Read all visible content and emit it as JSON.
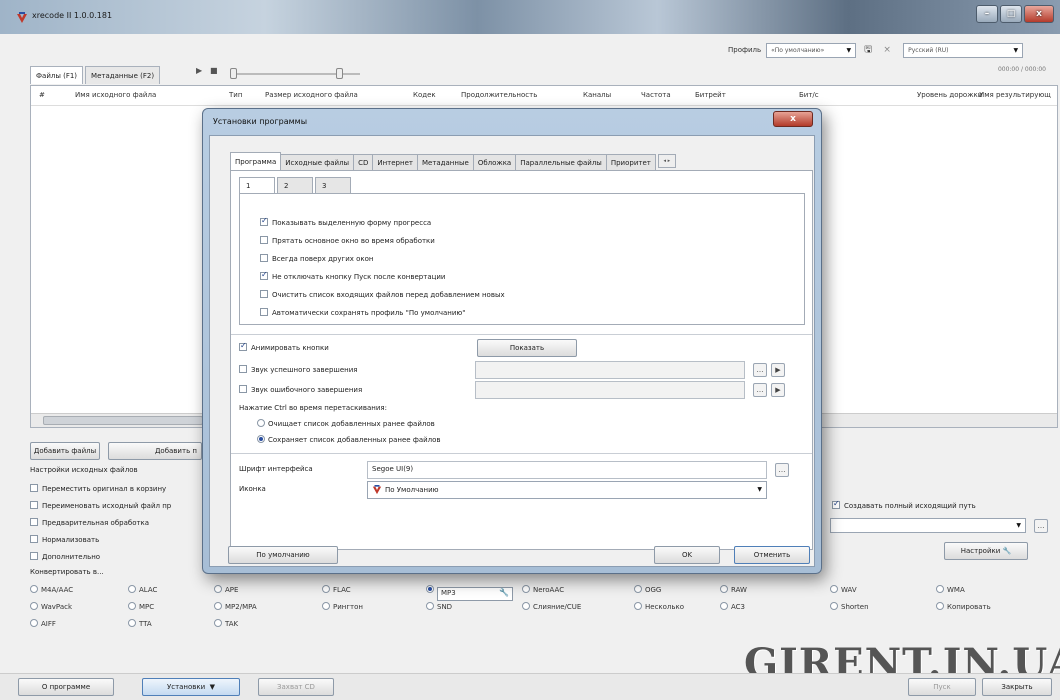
{
  "window": {
    "title": "xrecode II 1.0.0.181",
    "controls": [
      "–",
      "□",
      "x"
    ],
    "profile_label": "Профиль",
    "profile_value": "«По умолчанию»",
    "language_value": "Русский (RU)",
    "time": "000:00 / 000:00"
  },
  "main_tabs": [
    "Файлы (F1)",
    "Метаданные (F2)"
  ],
  "file_columns": [
    "#",
    "Имя исходного файла",
    "Тип",
    "Размер исходного файла",
    "Кодек",
    "Продолжительность",
    "Каналы",
    "Частота",
    "Битрейт",
    "Бит/с",
    "Уровень дорожки",
    "Имя результирующ"
  ],
  "buttons": {
    "add_files": "Добавить файлы",
    "add_folder": "Добавить п",
    "settings": "Настройки",
    "about": "О программе",
    "install": "Установки",
    "grab_cd": "Захват CD",
    "start": "Пуск",
    "close": "Закрыть"
  },
  "source_settings": {
    "title": "Настройки исходных файлов",
    "options": [
      {
        "label": "Переместить оригинал в корзину",
        "checked": false
      },
      {
        "label": "Переименовать исходный файл пр",
        "checked": false
      },
      {
        "label": "Предварительная обработка",
        "checked": false
      },
      {
        "label": "Нормализовать",
        "checked": false
      },
      {
        "label": "Дополнительно",
        "checked": false
      }
    ],
    "full_path_label": "Создавать полный исходящий путь",
    "full_path_checked": true
  },
  "convert": {
    "title": "Конвертировать в...",
    "formats": [
      [
        "M4A/AAC",
        "ALAC",
        "APE",
        "FLAC",
        "MP3",
        "NeroAAC",
        "OGG",
        "RAW",
        "WAV",
        "WMA"
      ],
      [
        "WavPack",
        "MPC",
        "MP2/MPA",
        "Рингтон",
        "SND",
        "Слияние/CUE",
        "Несколько",
        "AC3",
        "Shorten",
        "Копировать"
      ],
      [
        "AIFF",
        "TTA",
        "TAK"
      ]
    ],
    "selected": "MP3"
  },
  "watermark": "GIRENT.IN.UA",
  "dialog": {
    "title": "Установки программы",
    "close": "x",
    "tabs": [
      "Программа",
      "Исходные файлы",
      "CD",
      "Интернет",
      "Метаданные",
      "Обложка",
      "Параллельные файлы",
      "Приоритет"
    ],
    "tab_scroll": [
      "◂",
      "▸"
    ],
    "subtabs": [
      "1",
      "2",
      "3"
    ],
    "options": [
      {
        "label": "Показывать выделенную форму прогресса",
        "checked": true
      },
      {
        "label": "Прятать основное окно во время обработки",
        "checked": false
      },
      {
        "label": "Всегда поверх других окон",
        "checked": false
      },
      {
        "label": "Не отключать кнопку Пуск после конвертации",
        "checked": true
      },
      {
        "label": "Очистить список входящих файлов перед добавлением новых",
        "checked": false
      },
      {
        "label": "Автоматически сохранять профиль \"По умолчанию\"",
        "checked": false
      }
    ],
    "animate": {
      "label": "Анимировать кнопки",
      "checked": true
    },
    "show_button": "Показать",
    "sound_success": {
      "label": "Звук успешного завершения",
      "checked": false
    },
    "sound_error": {
      "label": "Звук ошибочного завершения",
      "checked": false
    },
    "ctrl_label": "Нажатие Ctrl во время перетаскивания:",
    "ctrl_options": [
      {
        "label": "Очищает список добавленных ранее файлов",
        "selected": false
      },
      {
        "label": "Сохраняет список добавленных ранее файлов",
        "selected": true
      }
    ],
    "font_label": "Шрифт интерфейса",
    "font_value": "Segoe UI(9)",
    "icon_label": "Иконка",
    "icon_value": "По Умолчанию",
    "defaults_button": "По умолчанию",
    "ok_button": "OK",
    "cancel_button": "Отменить"
  },
  "colors": {
    "accent": "#2a4ea0",
    "dialog_frame": "#a7bed6",
    "close_red": "#b23a29"
  }
}
